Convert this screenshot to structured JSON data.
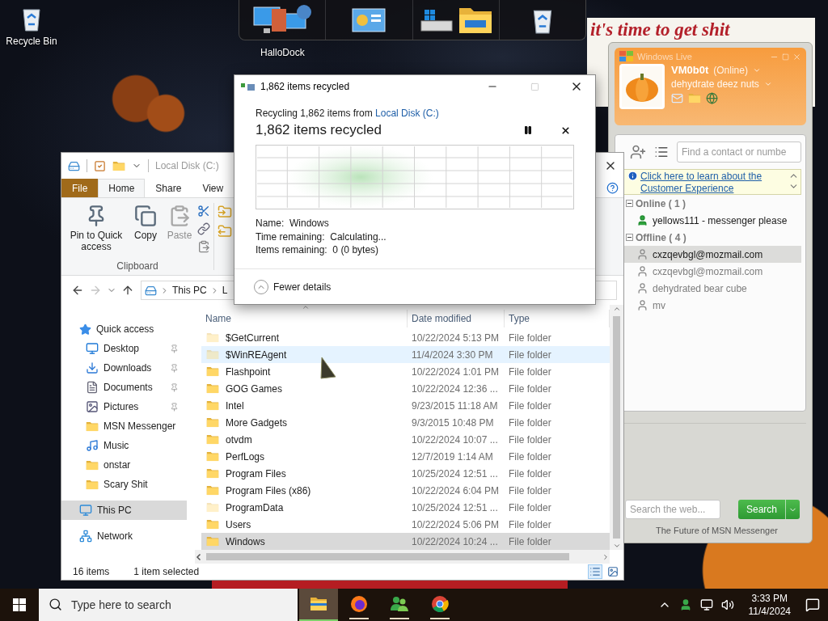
{
  "desktop": {
    "icons": [
      {
        "label": "Recycle Bin"
      }
    ]
  },
  "dock": {
    "label": "HalloDock"
  },
  "note": {
    "lines": [
      "it's time to get shit"
    ]
  },
  "explorer": {
    "title": "Local Disk (C:)",
    "tabs": [
      {
        "label": "File",
        "kind": "menu",
        "selected": false
      },
      {
        "label": "Home",
        "kind": "tab",
        "selected": true
      },
      {
        "label": "Share",
        "kind": "tab",
        "selected": false
      },
      {
        "label": "View",
        "kind": "tab",
        "selected": false
      }
    ],
    "ribbon": {
      "buttons": [
        {
          "label": "Pin to Quick access",
          "kind": "pin",
          "disabled": false
        },
        {
          "label": "Copy",
          "kind": "copy",
          "disabled": false
        },
        {
          "label": "Paste",
          "kind": "paste",
          "disabled": true
        }
      ],
      "group": "Clipboard"
    },
    "breadcrumbs": [
      "This PC",
      "L"
    ],
    "nav": [
      {
        "label": "Quick access",
        "kind": "star",
        "selected": false,
        "children": [
          {
            "label": "Desktop",
            "kind": "desktop",
            "pinned": true,
            "selected": false
          },
          {
            "label": "Downloads",
            "kind": "downloads",
            "pinned": true,
            "selected": false
          },
          {
            "label": "Documents",
            "kind": "documents",
            "pinned": true,
            "selected": false
          },
          {
            "label": "Pictures",
            "kind": "pictures",
            "pinned": true,
            "selected": false
          },
          {
            "label": "MSN Messenger",
            "kind": "folder",
            "pinned": false,
            "selected": false
          },
          {
            "label": "Music",
            "kind": "music",
            "pinned": false,
            "selected": false
          },
          {
            "label": "onstar",
            "kind": "folder",
            "pinned": false,
            "selected": false
          },
          {
            "label": "Scary Shit",
            "kind": "folder",
            "pinned": false,
            "selected": false
          }
        ]
      },
      {
        "label": "This PC",
        "kind": "pc",
        "selected": true
      },
      {
        "label": "Network",
        "kind": "network",
        "selected": false
      }
    ],
    "columns": [
      "Name",
      "Date modified",
      "Type"
    ],
    "rows": [
      {
        "name": "$GetCurrent",
        "date": "10/22/2024 5:13 PM",
        "type": "File folder",
        "hidden": true,
        "hovered": false,
        "selected": false
      },
      {
        "name": "$WinREAgent",
        "date": "11/4/2024 3:30 PM",
        "type": "File folder",
        "hidden": true,
        "hovered": true,
        "selected": false
      },
      {
        "name": "Flashpoint",
        "date": "10/22/2024 1:01 PM",
        "type": "File folder",
        "hidden": false,
        "hovered": false,
        "selected": false
      },
      {
        "name": "GOG Games",
        "date": "10/22/2024 12:36 ...",
        "type": "File folder",
        "hidden": false,
        "hovered": false,
        "selected": false
      },
      {
        "name": "Intel",
        "date": "9/23/2015 11:18 AM",
        "type": "File folder",
        "hidden": false,
        "hovered": false,
        "selected": false
      },
      {
        "name": "More Gadgets",
        "date": "9/3/2015 10:48 PM",
        "type": "File folder",
        "hidden": false,
        "hovered": false,
        "selected": false
      },
      {
        "name": "otvdm",
        "date": "10/22/2024 10:07 ...",
        "type": "File folder",
        "hidden": false,
        "hovered": false,
        "selected": false
      },
      {
        "name": "PerfLogs",
        "date": "12/7/2019 1:14 AM",
        "type": "File folder",
        "hidden": false,
        "hovered": false,
        "selected": false
      },
      {
        "name": "Program Files",
        "date": "10/25/2024 12:51 ...",
        "type": "File folder",
        "hidden": false,
        "hovered": false,
        "selected": false
      },
      {
        "name": "Program Files (x86)",
        "date": "10/22/2024 6:04 PM",
        "type": "File folder",
        "hidden": false,
        "hovered": false,
        "selected": false
      },
      {
        "name": "ProgramData",
        "date": "10/25/2024 12:51 ...",
        "type": "File folder",
        "hidden": true,
        "hovered": false,
        "selected": false
      },
      {
        "name": "Users",
        "date": "10/22/2024 5:06 PM",
        "type": "File folder",
        "hidden": false,
        "hovered": false,
        "selected": false
      },
      {
        "name": "Windows",
        "date": "10/22/2024 10:24 ...",
        "type": "File folder",
        "hidden": false,
        "hovered": false,
        "selected": true
      }
    ],
    "status": {
      "count": "16 items",
      "selection": "1 item selected"
    }
  },
  "dialog": {
    "title": "1,862 items recycled",
    "intro": "Recycling 1,862 items from ",
    "source": "Local Disk (C:)",
    "heading": "1,862 items recycled",
    "details": [
      "Name:  Windows",
      "Time remaining:  Calculating...",
      "Items remaining:  0 (0 bytes)"
    ],
    "toggle": "Fewer details"
  },
  "messenger": {
    "brand": "Windows Live",
    "name": "VM0b0t",
    "status": "(Online)",
    "message": "dehydrate deez nuts",
    "contact_search": {
      "placeholder": "Find a contact or numbe"
    },
    "info_link": "Click here to learn about the Customer Experience",
    "groups": [
      {
        "label": "Online ( 1 )",
        "expanded": true,
        "contacts": [
          {
            "name": "yellows111 - messenger please",
            "online": true,
            "selected": false
          }
        ]
      },
      {
        "label": "Offline ( 4 )",
        "expanded": true,
        "contacts": [
          {
            "name": "cxzqevbgl@mozmail.com",
            "online": false,
            "selected": true
          },
          {
            "name": "cxzqevbgl@mozmail.com",
            "online": false,
            "selected": false
          },
          {
            "name": "dehydrated bear cube",
            "online": false,
            "selected": false
          },
          {
            "name": "mv",
            "online": false,
            "selected": false
          }
        ]
      }
    ],
    "web_search": {
      "placeholder": "Search the web..."
    },
    "search_button": "Search",
    "footer": "The Future of MSN Messenger"
  },
  "taskbar": {
    "search": {
      "placeholder": "Type here to search"
    },
    "apps": [
      {
        "kind": "explorer",
        "active": true
      },
      {
        "kind": "firefox",
        "active": false
      },
      {
        "kind": "messenger",
        "active": false
      },
      {
        "kind": "chrome",
        "active": false
      }
    ],
    "time": "3:33 PM",
    "date": "11/4/2024"
  }
}
